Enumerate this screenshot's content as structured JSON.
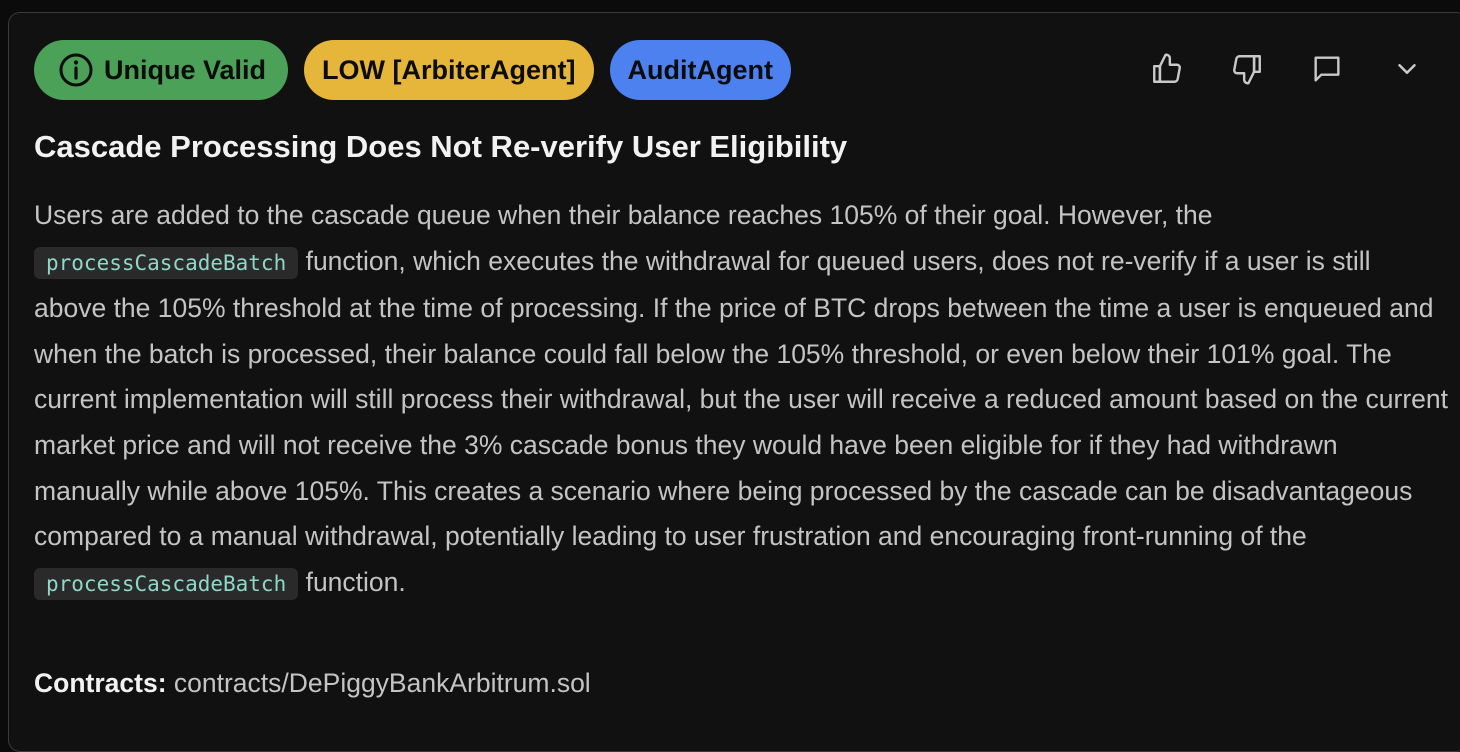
{
  "badges": {
    "valid": {
      "label": "Unique Valid",
      "icon": "info-icon",
      "color": "#4aa157"
    },
    "severity": {
      "label": "LOW [ArbiterAgent]",
      "color": "#e6b63a"
    },
    "agent": {
      "label": "AuditAgent",
      "color": "#4d81f0"
    }
  },
  "actions": [
    {
      "icon": "thumbs-up-icon"
    },
    {
      "icon": "thumbs-down-icon"
    },
    {
      "icon": "comment-icon"
    },
    {
      "icon": "chevron-down-icon"
    }
  ],
  "finding": {
    "title": "Cascade Processing Does Not Re-verify User Eligibility",
    "description": {
      "part1": "Users are added to the cascade queue when their balance reaches 105% of their goal. However, the ",
      "code1": "processCascadeBatch",
      "part2": " function, which executes the withdrawal for queued users, does not re-verify if a user is still above the 105% threshold at the time of processing. If the price of BTC drops between the time a user is enqueued and when the batch is processed, their balance could fall below the 105% threshold, or even below their 101% goal. The current implementation will still process their withdrawal, but the user will receive a reduced amount based on the current market price and will not receive the 3% cascade bonus they would have been eligible for if they had withdrawn manually while above 105%. This creates a scenario where being processed by the cascade can be disadvantageous compared to a manual withdrawal, potentially leading to user frustration and encouraging front-running of the ",
      "code2": "processCascadeBatch",
      "part3": " function."
    },
    "contracts_label": "Contracts:",
    "contracts_value": "contracts/DePiggyBankArbitrum.sol"
  },
  "colors": {
    "background": "#111111",
    "border": "#3a3a3a",
    "code_text": "#8fd8c8",
    "code_bg": "#2a2a2a"
  }
}
